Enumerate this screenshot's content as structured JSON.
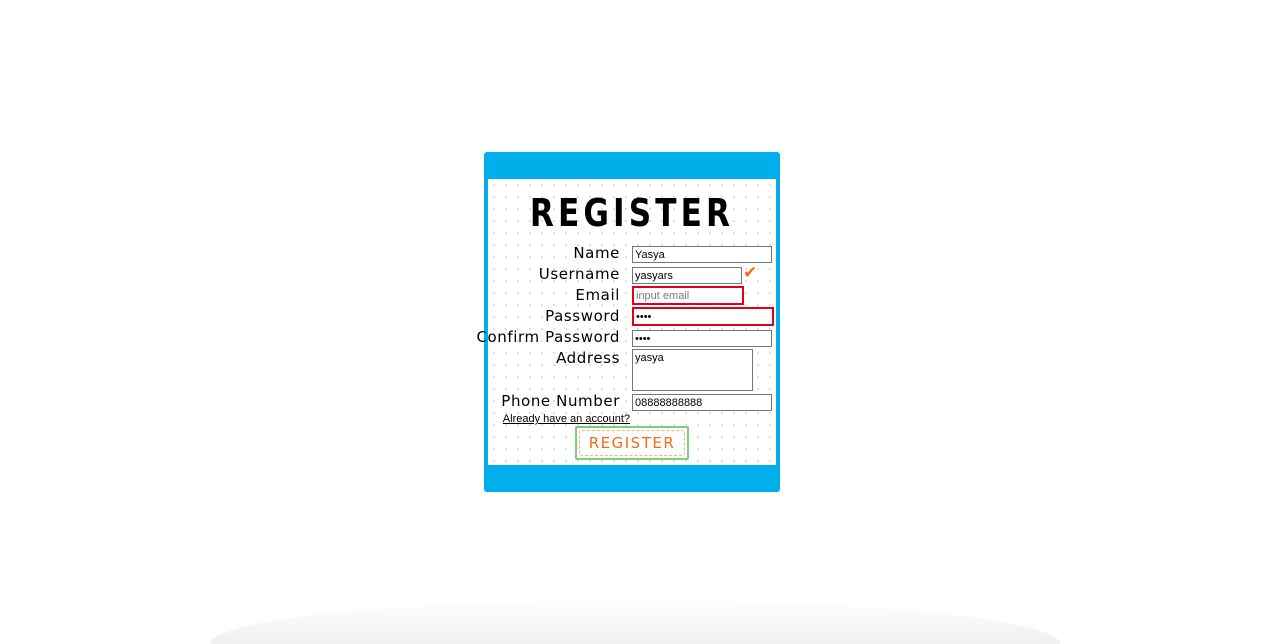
{
  "form": {
    "title": "REGISTER",
    "fields": {
      "name": {
        "label": "Name",
        "value": "Yasya"
      },
      "username": {
        "label": "Username",
        "value": "yasyars"
      },
      "email": {
        "label": "Email",
        "value": "",
        "placeholder": "input email"
      },
      "password": {
        "label": "Password",
        "value": "••••"
      },
      "confirm_password": {
        "label": "Confirm Password",
        "value": "••••"
      },
      "address": {
        "label": "Address",
        "value": "yasya"
      },
      "phone": {
        "label": "Phone Number",
        "value": "08888888888"
      }
    },
    "login_link": "Already have an account?",
    "submit_label": "REGISTER"
  },
  "icons": {
    "username_valid": "check-icon"
  },
  "colors": {
    "card_background": "#00aee9",
    "error_border": "#e3001b",
    "accent": "#f26b1d",
    "button_border": "#7ccf7a"
  }
}
